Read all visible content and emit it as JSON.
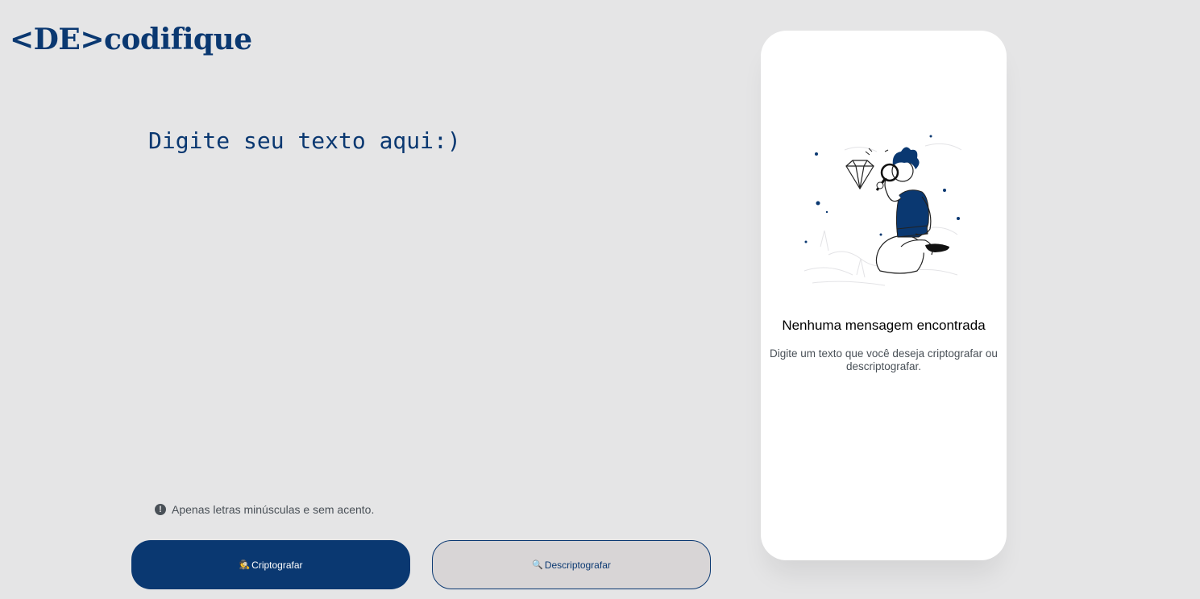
{
  "header": {
    "logo": "<DE>codifique"
  },
  "editor": {
    "placeholder": "Digite seu texto aqui:)",
    "value": ""
  },
  "hint": {
    "icon": "exclamation-circle-icon",
    "text": "Apenas letras minúsculas e sem acento."
  },
  "buttons": {
    "encrypt": {
      "icon": "🕵️",
      "label": "Criptografar"
    },
    "decrypt": {
      "icon": "🔍",
      "label": "Descriptografar"
    }
  },
  "result": {
    "title": "Nenhuma mensagem encontrada",
    "text": "Digite um texto que você deseja criptografar ou descriptografar."
  },
  "colors": {
    "primary": "#0a3871",
    "background": "#e5e5e6",
    "secondary_button": "#d8d5d6",
    "card": "#ffffff"
  }
}
